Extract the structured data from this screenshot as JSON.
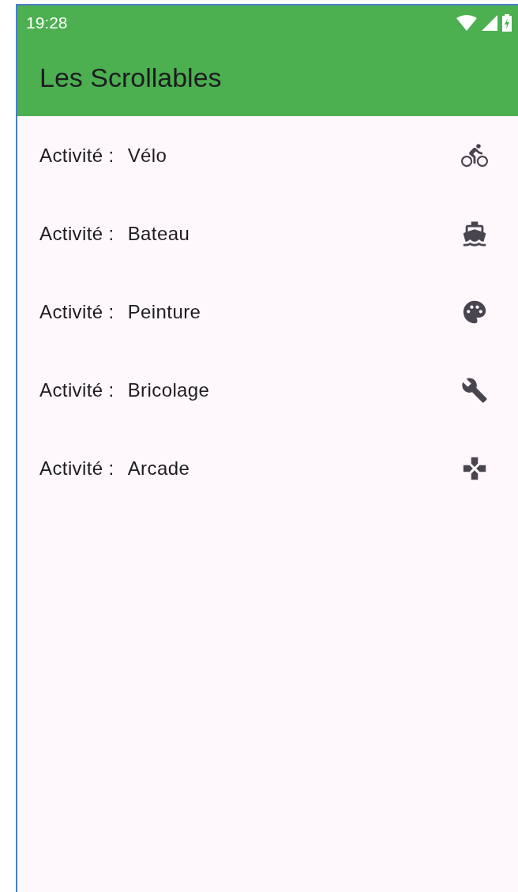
{
  "status_bar": {
    "time": "19:28"
  },
  "app_bar": {
    "title": "Les Scrollables"
  },
  "items": [
    {
      "label": "Activité :",
      "name": "Vélo",
      "kind": "bike"
    },
    {
      "label": "Activité :",
      "name": "Bateau",
      "kind": "boat"
    },
    {
      "label": "Activité :",
      "name": "Peinture",
      "kind": "palette"
    },
    {
      "label": "Activité :",
      "name": "Bricolage",
      "kind": "wrench"
    },
    {
      "label": "Activité :",
      "name": "Arcade",
      "kind": "gamepad"
    }
  ]
}
